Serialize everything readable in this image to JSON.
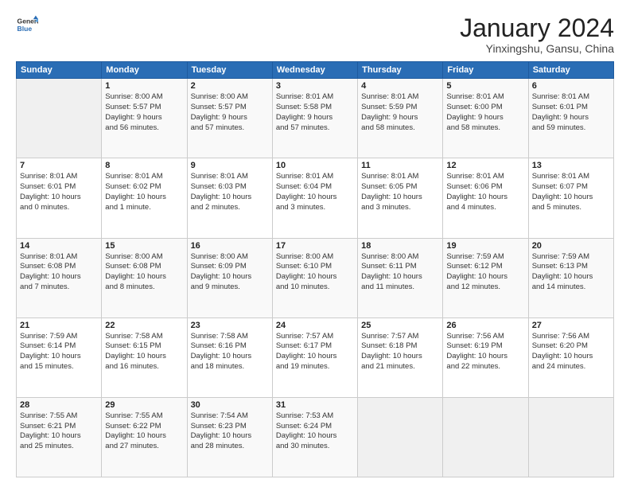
{
  "header": {
    "logo": {
      "general": "General",
      "blue": "Blue"
    },
    "title": "January 2024",
    "subtitle": "Yinxingshu, Gansu, China"
  },
  "days_of_week": [
    "Sunday",
    "Monday",
    "Tuesday",
    "Wednesday",
    "Thursday",
    "Friday",
    "Saturday"
  ],
  "weeks": [
    [
      {
        "day": "",
        "info": ""
      },
      {
        "day": "1",
        "info": "Sunrise: 8:00 AM\nSunset: 5:57 PM\nDaylight: 9 hours\nand 56 minutes."
      },
      {
        "day": "2",
        "info": "Sunrise: 8:00 AM\nSunset: 5:57 PM\nDaylight: 9 hours\nand 57 minutes."
      },
      {
        "day": "3",
        "info": "Sunrise: 8:01 AM\nSunset: 5:58 PM\nDaylight: 9 hours\nand 57 minutes."
      },
      {
        "day": "4",
        "info": "Sunrise: 8:01 AM\nSunset: 5:59 PM\nDaylight: 9 hours\nand 58 minutes."
      },
      {
        "day": "5",
        "info": "Sunrise: 8:01 AM\nSunset: 6:00 PM\nDaylight: 9 hours\nand 58 minutes."
      },
      {
        "day": "6",
        "info": "Sunrise: 8:01 AM\nSunset: 6:01 PM\nDaylight: 9 hours\nand 59 minutes."
      }
    ],
    [
      {
        "day": "7",
        "info": "Sunrise: 8:01 AM\nSunset: 6:01 PM\nDaylight: 10 hours\nand 0 minutes."
      },
      {
        "day": "8",
        "info": "Sunrise: 8:01 AM\nSunset: 6:02 PM\nDaylight: 10 hours\nand 1 minute."
      },
      {
        "day": "9",
        "info": "Sunrise: 8:01 AM\nSunset: 6:03 PM\nDaylight: 10 hours\nand 2 minutes."
      },
      {
        "day": "10",
        "info": "Sunrise: 8:01 AM\nSunset: 6:04 PM\nDaylight: 10 hours\nand 3 minutes."
      },
      {
        "day": "11",
        "info": "Sunrise: 8:01 AM\nSunset: 6:05 PM\nDaylight: 10 hours\nand 3 minutes."
      },
      {
        "day": "12",
        "info": "Sunrise: 8:01 AM\nSunset: 6:06 PM\nDaylight: 10 hours\nand 4 minutes."
      },
      {
        "day": "13",
        "info": "Sunrise: 8:01 AM\nSunset: 6:07 PM\nDaylight: 10 hours\nand 5 minutes."
      }
    ],
    [
      {
        "day": "14",
        "info": "Sunrise: 8:01 AM\nSunset: 6:08 PM\nDaylight: 10 hours\nand 7 minutes."
      },
      {
        "day": "15",
        "info": "Sunrise: 8:00 AM\nSunset: 6:08 PM\nDaylight: 10 hours\nand 8 minutes."
      },
      {
        "day": "16",
        "info": "Sunrise: 8:00 AM\nSunset: 6:09 PM\nDaylight: 10 hours\nand 9 minutes."
      },
      {
        "day": "17",
        "info": "Sunrise: 8:00 AM\nSunset: 6:10 PM\nDaylight: 10 hours\nand 10 minutes."
      },
      {
        "day": "18",
        "info": "Sunrise: 8:00 AM\nSunset: 6:11 PM\nDaylight: 10 hours\nand 11 minutes."
      },
      {
        "day": "19",
        "info": "Sunrise: 7:59 AM\nSunset: 6:12 PM\nDaylight: 10 hours\nand 12 minutes."
      },
      {
        "day": "20",
        "info": "Sunrise: 7:59 AM\nSunset: 6:13 PM\nDaylight: 10 hours\nand 14 minutes."
      }
    ],
    [
      {
        "day": "21",
        "info": "Sunrise: 7:59 AM\nSunset: 6:14 PM\nDaylight: 10 hours\nand 15 minutes."
      },
      {
        "day": "22",
        "info": "Sunrise: 7:58 AM\nSunset: 6:15 PM\nDaylight: 10 hours\nand 16 minutes."
      },
      {
        "day": "23",
        "info": "Sunrise: 7:58 AM\nSunset: 6:16 PM\nDaylight: 10 hours\nand 18 minutes."
      },
      {
        "day": "24",
        "info": "Sunrise: 7:57 AM\nSunset: 6:17 PM\nDaylight: 10 hours\nand 19 minutes."
      },
      {
        "day": "25",
        "info": "Sunrise: 7:57 AM\nSunset: 6:18 PM\nDaylight: 10 hours\nand 21 minutes."
      },
      {
        "day": "26",
        "info": "Sunrise: 7:56 AM\nSunset: 6:19 PM\nDaylight: 10 hours\nand 22 minutes."
      },
      {
        "day": "27",
        "info": "Sunrise: 7:56 AM\nSunset: 6:20 PM\nDaylight: 10 hours\nand 24 minutes."
      }
    ],
    [
      {
        "day": "28",
        "info": "Sunrise: 7:55 AM\nSunset: 6:21 PM\nDaylight: 10 hours\nand 25 minutes."
      },
      {
        "day": "29",
        "info": "Sunrise: 7:55 AM\nSunset: 6:22 PM\nDaylight: 10 hours\nand 27 minutes."
      },
      {
        "day": "30",
        "info": "Sunrise: 7:54 AM\nSunset: 6:23 PM\nDaylight: 10 hours\nand 28 minutes."
      },
      {
        "day": "31",
        "info": "Sunrise: 7:53 AM\nSunset: 6:24 PM\nDaylight: 10 hours\nand 30 minutes."
      },
      {
        "day": "",
        "info": ""
      },
      {
        "day": "",
        "info": ""
      },
      {
        "day": "",
        "info": ""
      }
    ]
  ]
}
